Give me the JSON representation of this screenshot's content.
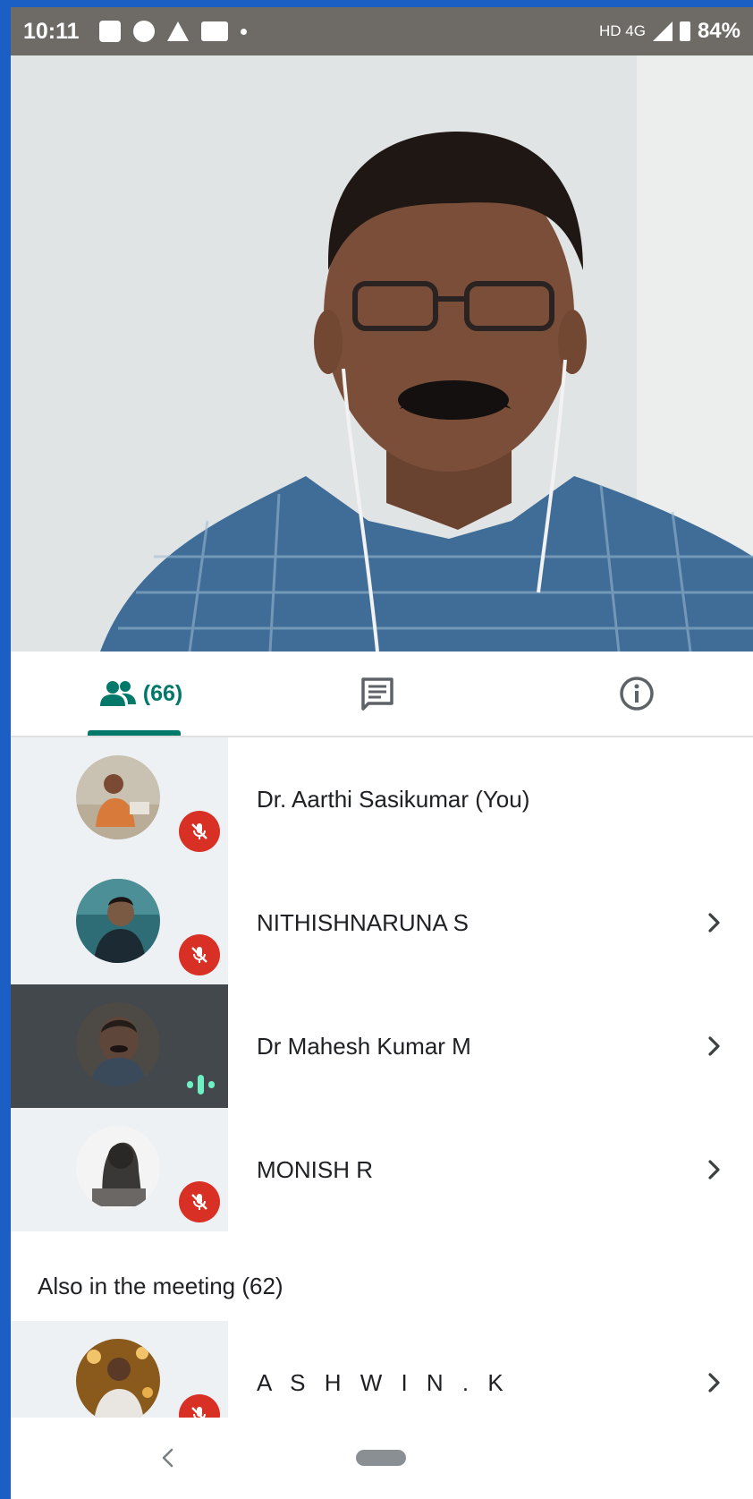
{
  "status_bar": {
    "time": "10:11",
    "network": "HD 4G",
    "battery": "84%"
  },
  "tabs": {
    "people_count": "(66)",
    "active": "people"
  },
  "participants": [
    {
      "name": "Dr. Aarthi Sasikumar (You)",
      "muted": true,
      "chevron": false
    },
    {
      "name": "NITHISHNARUNA S",
      "muted": true,
      "chevron": true
    },
    {
      "name": "Dr Mahesh Kumar M",
      "muted": false,
      "speaking": true,
      "chevron": true
    },
    {
      "name": "MONISH R",
      "muted": true,
      "chevron": true
    }
  ],
  "also_in_meeting": {
    "header": "Also in the meeting (62)",
    "participants": [
      {
        "name": "A S H W I N . K",
        "muted": true,
        "chevron": true
      }
    ]
  },
  "colors": {
    "accent": "#00796b",
    "mic_off": "#d93025",
    "speaking_bg": "#43484d",
    "frame": "#1b5fc4"
  }
}
